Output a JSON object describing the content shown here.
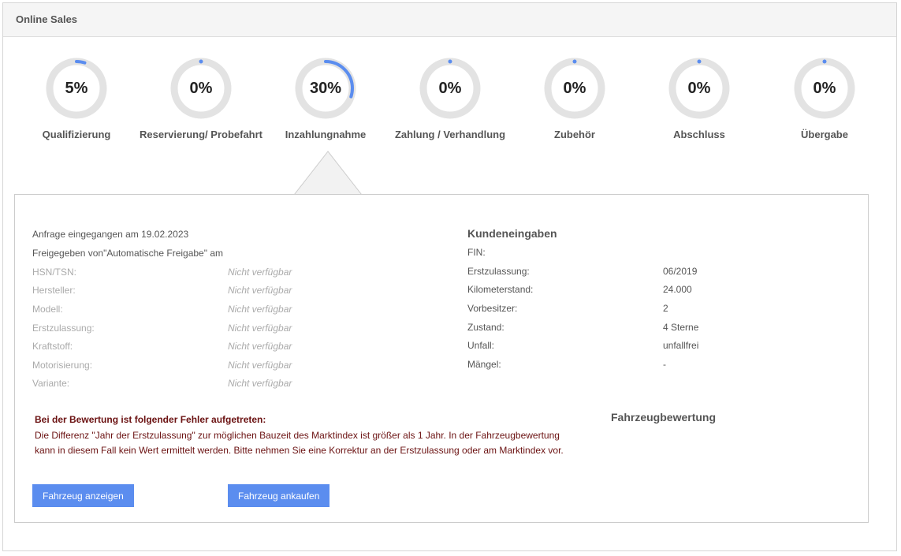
{
  "panel": {
    "title": "Online Sales"
  },
  "steps": [
    {
      "percent_label": "5%",
      "progress": 0.05,
      "label": "Qualifizierung"
    },
    {
      "percent_label": "0%",
      "progress": 0.0,
      "label": "Reservierung/ Probefahrt"
    },
    {
      "percent_label": "30%",
      "progress": 0.3,
      "label": "Inzahlungnahme"
    },
    {
      "percent_label": "0%",
      "progress": 0.0,
      "label": "Zahlung / Verhandlung"
    },
    {
      "percent_label": "0%",
      "progress": 0.0,
      "label": "Zubehör"
    },
    {
      "percent_label": "0%",
      "progress": 0.0,
      "label": "Abschluss"
    },
    {
      "percent_label": "0%",
      "progress": 0.0,
      "label": "Übergabe"
    }
  ],
  "colors": {
    "ring_track": "#e3e3e3",
    "ring_progress": "#5b8def",
    "button_bg": "#5b8def",
    "error_text": "#6b1212"
  },
  "left": {
    "request_received": "Anfrage eingegangen am 19.02.2023",
    "released_by": "Freigegeben von\"Automatische Freigabe\" am",
    "fields": [
      {
        "label": "HSN/TSN:",
        "value": "Nicht verfügbar"
      },
      {
        "label": "Hersteller:",
        "value": "Nicht verfügbar"
      },
      {
        "label": "Modell:",
        "value": "Nicht verfügbar"
      },
      {
        "label": "Erstzulassung:",
        "value": "Nicht verfügbar"
      },
      {
        "label": "Kraftstoff:",
        "value": "Nicht verfügbar"
      },
      {
        "label": "Motorisierung:",
        "value": "Nicht verfügbar"
      },
      {
        "label": "Variante:",
        "value": "Nicht verfügbar"
      }
    ]
  },
  "right": {
    "title": "Kundeneingaben",
    "fields": [
      {
        "label": "FIN:",
        "value": ""
      },
      {
        "label": "Erstzulassung:",
        "value": "06/2019"
      },
      {
        "label": "Kilometerstand:",
        "value": "24.000"
      },
      {
        "label": "Vorbesitzer:",
        "value": "2"
      },
      {
        "label": "Zustand:",
        "value": "4 Sterne"
      },
      {
        "label": "Unfall:",
        "value": "unfallfrei"
      },
      {
        "label": "Mängel:",
        "value": "-"
      }
    ]
  },
  "error": {
    "title": "Bei der Bewertung ist folgender Fehler aufgetreten:",
    "message": "Die Differenz \"Jahr der Erstzulassung\" zur möglichen Bauzeit des Marktindex ist größer als 1 Jahr. In der Fahrzeugbewertung kann in diesem Fall kein Wert ermittelt werden. Bitte nehmen Sie eine Korrektur an der Erstzulassung oder am Marktindex vor."
  },
  "valuation": {
    "title": "Fahrzeugbewertung"
  },
  "buttons": {
    "show_vehicle": "Fahrzeug anzeigen",
    "buy_vehicle": "Fahrzeug ankaufen"
  }
}
